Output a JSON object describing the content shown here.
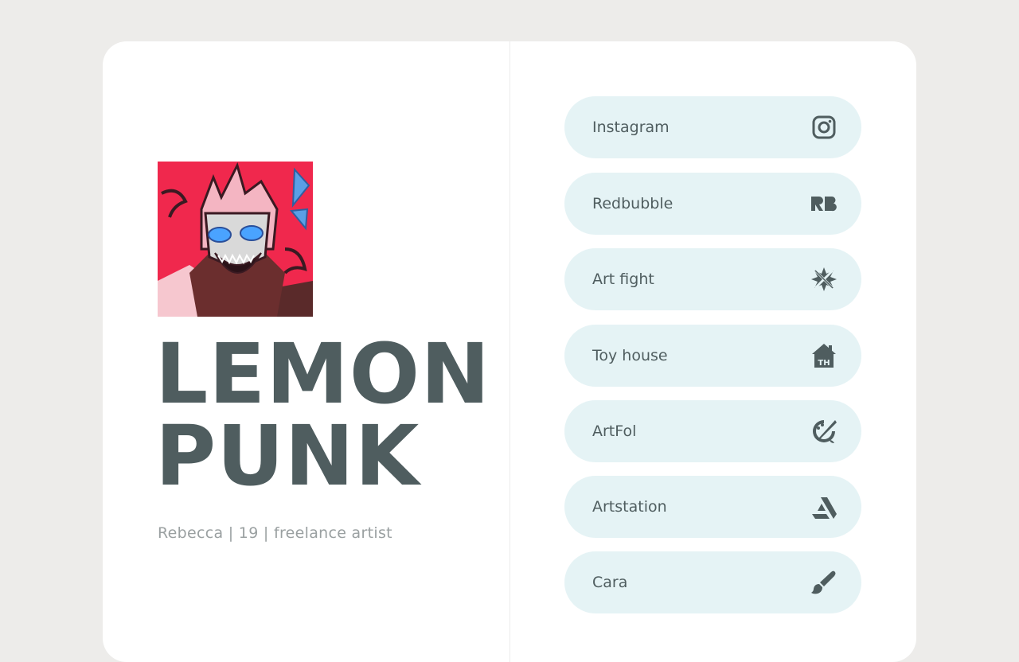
{
  "profile": {
    "name_line1": "LEMON",
    "name_line2": "PUNK",
    "subtitle": "Rebecca | 19 | freelance artist"
  },
  "links": [
    {
      "label": "Instagram",
      "icon": "instagram-icon"
    },
    {
      "label": "Redbubble",
      "icon": "redbubble-icon"
    },
    {
      "label": "Art fight",
      "icon": "artfight-icon"
    },
    {
      "label": "Toy house",
      "icon": "toyhouse-icon"
    },
    {
      "label": "ArtFol",
      "icon": "artfol-icon"
    },
    {
      "label": "Artstation",
      "icon": "artstation-icon"
    },
    {
      "label": "Cara",
      "icon": "paintbrush-icon"
    }
  ],
  "colors": {
    "page_bg": "#edecea",
    "card_bg": "#ffffff",
    "link_bg": "#e5f3f5",
    "text_dark": "#4f5d5f",
    "text_muted": "#9aa0a1",
    "avatar_bg": "#f0284d"
  }
}
